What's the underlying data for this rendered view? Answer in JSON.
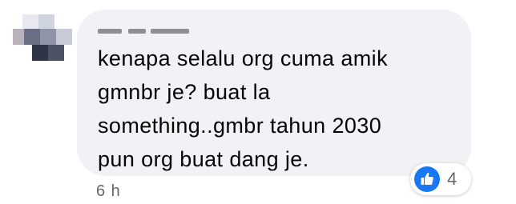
{
  "comment": {
    "author_name": "",
    "text_lines": [
      "kenapa selalu org cuma amik",
      "gmnbr je? buat la",
      "something..gmbr tahun 2030",
      "pun org buat dang je."
    ],
    "timestamp": "6 h"
  },
  "reactions": {
    "icon": "like-icon",
    "count": "4",
    "accent": "#1877f2"
  },
  "colors": {
    "bubble": "#f0f2f5",
    "text": "#050505",
    "secondary": "#65676b"
  }
}
